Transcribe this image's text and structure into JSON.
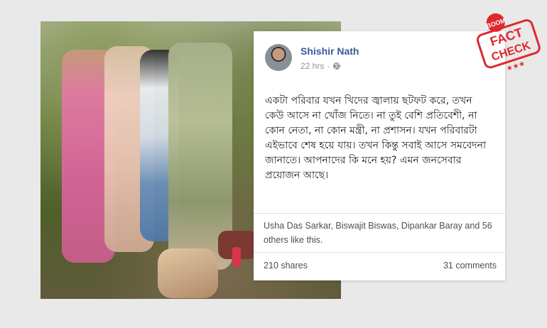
{
  "post": {
    "author": "Shishir Nath",
    "time": "22 hrs",
    "text": "একটা পরিবার যখন খিদের জ্বালায় ছটফট করে, তখন কেউ আসে না খোঁজ নিতে। না তুই বেশি প্রতিবেশী, না কোন নেতা, না কোন মন্ত্রী, না প্রশাসন। যখন পরিবারটা এইভাবে শেষ হয়ে যায়। তখন কিন্তু সবাই আসে সমবেদনা জানাতে। আপনাদের কি মনে হয়? এমন জনসেবার প্রয়োজন আছে।",
    "likes_text": "Usha Das Sarkar, Biswajit Biswas, Dipankar Baray and 56 others like this.",
    "shares": "210 shares",
    "comments": "31 comments"
  },
  "badge": {
    "top_text": "BOOM",
    "line1": "FACT",
    "line2": "CHECK",
    "stars": "★★★",
    "color": "#e0282e"
  },
  "icons": {
    "privacy": "globe-icon",
    "badge": "fact-check-stamp"
  }
}
